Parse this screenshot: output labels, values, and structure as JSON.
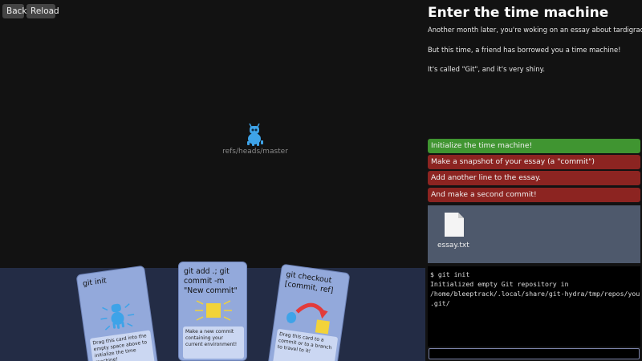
{
  "toolbar": {
    "back_label": "Back",
    "reload_label": "Reload"
  },
  "graph": {
    "ref_label": "refs/heads/master"
  },
  "level": {
    "title": "Enter the time machine",
    "description": [
      "Another month later, you're woking on an essay about tardigrades!",
      "But this time, a friend has borrowed you a time machine!",
      "It's called \"Git\", and it's very shiny."
    ]
  },
  "tasks": [
    {
      "label": "Initialize the time machine!",
      "status": "done"
    },
    {
      "label": "Make a snapshot of your essay (a \"commit\")",
      "status": "todo"
    },
    {
      "label": "Add another line to the essay.",
      "status": "todo"
    },
    {
      "label": "And make a second commit!",
      "status": "todo"
    }
  ],
  "files": [
    {
      "name": "essay.txt",
      "icon": "file-icon"
    }
  ],
  "terminal": {
    "lines": [
      "$ git init",
      "Initialized empty Git repository in",
      "/home/bleeptrack/.local/share/git-hydra/tmp/repos/yours/",
      ".git/"
    ],
    "input_value": ""
  },
  "cards": {
    "init": {
      "title": "git init",
      "desc": "Drag this card into the empty space above to initialize the time machine!",
      "icon": "mascot-icon"
    },
    "add": {
      "title": "git add .; git commit -m \"New commit\"",
      "desc": "Make a new commit containing your current environment!",
      "icon": "commit-square-icon"
    },
    "checkout": {
      "title": "git checkout [commit, ref]",
      "desc": "Drag this card to a commit or to a branch to travel to it!",
      "icon": "travel-arrow-icon"
    }
  },
  "colors": {
    "task_done": "#409531",
    "task_todo": "#8c2421",
    "card_bg": "#93a9db",
    "tray_bg": "#232c45",
    "mascot": "#3ea3e8"
  }
}
